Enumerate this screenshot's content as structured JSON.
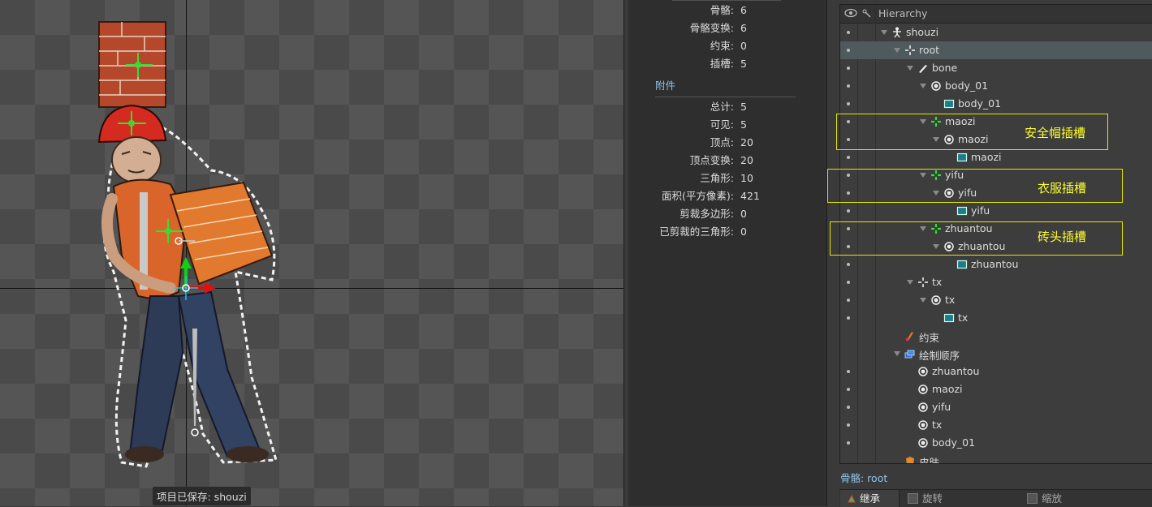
{
  "viewport": {
    "toast": "项目已保存: shouzi"
  },
  "metrics": {
    "skeleton_rows": [
      {
        "label": "骨骼:",
        "value": "6"
      },
      {
        "label": "骨骼变换:",
        "value": "6"
      },
      {
        "label": "约束:",
        "value": "0"
      },
      {
        "label": "插槽:",
        "value": "5"
      }
    ],
    "attachments_title": "附件",
    "attachment_rows": [
      {
        "label": "总计:",
        "value": "5"
      },
      {
        "label": "可见:",
        "value": "5"
      },
      {
        "label": "顶点:",
        "value": "20"
      },
      {
        "label": "顶点变换:",
        "value": "20"
      },
      {
        "label": "三角形:",
        "value": "10"
      },
      {
        "label": "面积(平方像素):",
        "value": "421"
      },
      {
        "label": "剪裁多边形:",
        "value": "0"
      },
      {
        "label": "已剪裁的三角形:",
        "value": "0"
      }
    ]
  },
  "hierarchy": {
    "title": "Hierarchy",
    "nodes": [
      {
        "label": "shouzi",
        "icon": "skeleton-icon",
        "level": 0,
        "expanded": true
      },
      {
        "label": "root",
        "icon": "bone-root-icon",
        "level": 1,
        "expanded": true,
        "selected": true
      },
      {
        "label": "bone",
        "icon": "bone-icon",
        "level": 2,
        "expanded": true
      },
      {
        "label": "body_01",
        "icon": "slot-icon",
        "level": 3,
        "expanded": true
      },
      {
        "label": "body_01",
        "icon": "region-icon",
        "level": 4
      },
      {
        "label": "maozi",
        "icon": "bone-green-icon",
        "level": 3,
        "expanded": true
      },
      {
        "label": "maozi",
        "icon": "slot-icon",
        "level": 4,
        "expanded": true
      },
      {
        "label": "maozi",
        "icon": "region-icon",
        "level": 5
      },
      {
        "label": "yifu",
        "icon": "bone-green-icon",
        "level": 3,
        "expanded": true
      },
      {
        "label": "yifu",
        "icon": "slot-icon",
        "level": 4,
        "expanded": true
      },
      {
        "label": "yifu",
        "icon": "region-icon",
        "level": 5
      },
      {
        "label": "zhuantou",
        "icon": "bone-green-icon",
        "level": 3,
        "expanded": true
      },
      {
        "label": "zhuantou",
        "icon": "slot-icon",
        "level": 4,
        "expanded": true
      },
      {
        "label": "zhuantou",
        "icon": "region-icon",
        "level": 5
      },
      {
        "label": "tx",
        "icon": "bone-root-icon",
        "level": 2,
        "expanded": true
      },
      {
        "label": "tx",
        "icon": "slot-icon",
        "level": 3,
        "expanded": true
      },
      {
        "label": "tx",
        "icon": "region-icon",
        "level": 4
      },
      {
        "label": "约束",
        "icon": "constraint-icon",
        "level": 1,
        "nodot": true
      },
      {
        "label": "绘制顺序",
        "icon": "draw-order-icon",
        "level": 1,
        "expanded": true,
        "nodot": true
      },
      {
        "label": "zhuantou",
        "icon": "slot-icon",
        "level": 2
      },
      {
        "label": "maozi",
        "icon": "slot-icon",
        "level": 2
      },
      {
        "label": "yifu",
        "icon": "slot-icon",
        "level": 2
      },
      {
        "label": "tx",
        "icon": "slot-icon",
        "level": 2
      },
      {
        "label": "body_01",
        "icon": "slot-icon",
        "level": 2
      },
      {
        "label": "皮肤",
        "icon": "skin-icon",
        "level": 1,
        "nodot": true
      }
    ],
    "annotations": [
      "安全帽插槽",
      "衣服插槽",
      "砖头插槽"
    ]
  },
  "status": {
    "bone": "骨骼: root"
  },
  "bottom_bar": {
    "inherit": "继承",
    "rotate": "旋转",
    "scale": "缩放"
  },
  "colors": {
    "annotation": "#ffff2b",
    "accent_blue": "#8fc2e8",
    "selection": "#4f5a5c"
  }
}
